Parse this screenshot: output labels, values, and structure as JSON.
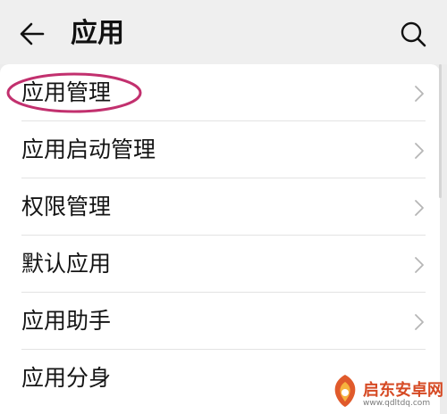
{
  "header": {
    "title": "应用",
    "back_icon": "back-arrow-icon",
    "search_icon": "search-icon"
  },
  "menu": {
    "items": [
      {
        "label": "应用管理",
        "highlighted": true
      },
      {
        "label": "应用启动管理",
        "highlighted": false
      },
      {
        "label": "权限管理",
        "highlighted": false
      },
      {
        "label": "默认应用",
        "highlighted": false
      },
      {
        "label": "应用助手",
        "highlighted": false
      },
      {
        "label": "应用分身",
        "highlighted": false
      }
    ],
    "chevron_icon": "chevron-right-icon"
  },
  "annotation": {
    "color": "#c2306e"
  },
  "watermark": {
    "name": "启东安卓网",
    "url": "www.qdltdq.com",
    "color": "#d64a24"
  }
}
